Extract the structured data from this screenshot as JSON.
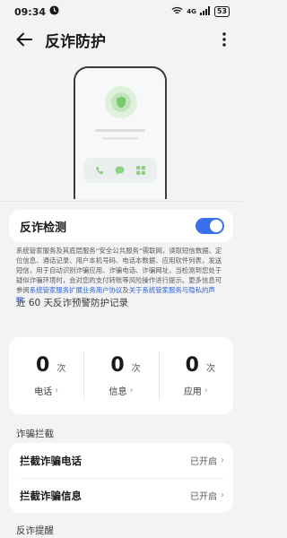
{
  "status_bar": {
    "time": "09:34",
    "network": "4G",
    "battery": "53"
  },
  "header": {
    "title": "反诈防护"
  },
  "toggle": {
    "label": "反诈检测",
    "enabled": true
  },
  "description": {
    "text": "系统管家服务及其底层服务“安全公共服务”需联网，读取短信数据、定位信息、通话记录、用户本机号码、电话本数据、应用软件列表，发送短信，用于自动识别诈骗应用、诈骗电话、诈骗网址，当检测到您处于疑似诈骗环境时，会对您的支付转账等风险操作进行提示。更多信息可参阅",
    "link1": "系统管家服务扩展业务用户协议",
    "connector": "及",
    "link2": "关于系统管家服务与隐私的声明",
    "end": "。"
  },
  "records": {
    "title": "近 60 天反诈预警防护记录",
    "items": [
      {
        "count": "0",
        "unit": "次",
        "label": "电话"
      },
      {
        "count": "0",
        "unit": "次",
        "label": "信息"
      },
      {
        "count": "0",
        "unit": "次",
        "label": "应用"
      }
    ]
  },
  "intercept": {
    "title": "诈骗拦截",
    "items": [
      {
        "label": "拦截诈骗电话",
        "status": "已开启"
      },
      {
        "label": "拦截诈骗信息",
        "status": "已开启"
      }
    ]
  },
  "remind": {
    "title": "反诈提醒"
  },
  "colors": {
    "accent": "#3c6fea",
    "shield": "#7cc86f",
    "background": "#f1f3f5"
  }
}
